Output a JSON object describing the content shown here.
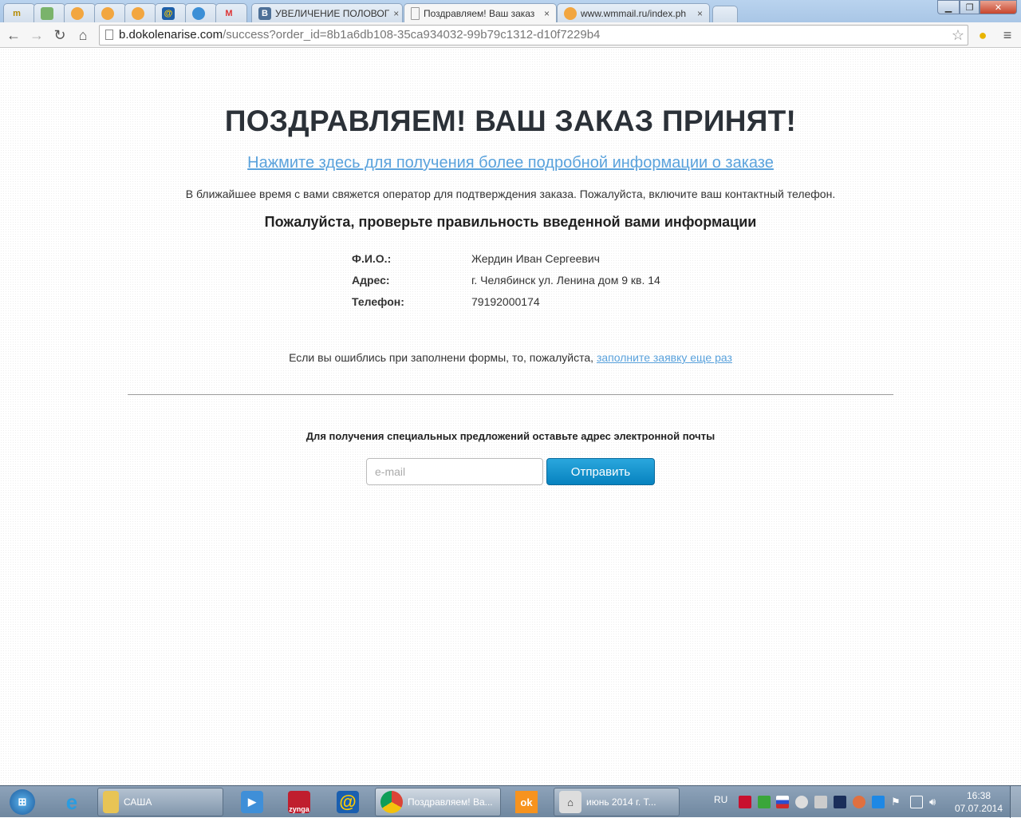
{
  "browser": {
    "tabs": [
      {
        "label": "УВЕЛИЧЕНИЕ ПОЛОВОГ",
        "icon": "vk-icon"
      },
      {
        "label": "Поздравляем! Ваш заказ",
        "icon": "page-icon",
        "active": true
      },
      {
        "label": "www.wmmail.ru/index.ph",
        "icon": "wmmail-icon"
      }
    ],
    "close_glyph": "×",
    "url_host": "b.dokolenarise.com",
    "url_path": "/success?order_id=8b1a6db108-35ca934032-99b79c1312-d10f7229b4"
  },
  "page": {
    "title": "ПОЗДРАВЛЯЕМ! ВАШ ЗАКАЗ ПРИНЯТ!",
    "details_link": "Нажмите здесь для получения более подробной информации о заказе",
    "notice": "В ближайшее время с вами свяжется оператор для подтверждения заказа. Пожалуйста, включите ваш контактный телефон.",
    "check_heading": "Пожалуйста, проверьте правильность введенной вами информации",
    "info": [
      {
        "label": "Ф.И.О.:",
        "value": "Жердин Иван Сергеевич"
      },
      {
        "label": "Адрес:",
        "value": "г. Челябинск ул. Ленина дом 9 кв. 14"
      },
      {
        "label": "Телефон:",
        "value": "79192000174"
      }
    ],
    "mistake_text": "Если вы ошиблись при заполнени формы, то, пожалуйста, ",
    "mistake_link": "заполните заявку еще раз",
    "promo_text": "Для получения специальных предложений оставьте адрес электронной почты",
    "email_placeholder": "e-mail",
    "email_value": "",
    "send_label": "Отправить"
  },
  "taskbar": {
    "items": [
      {
        "label": "САША"
      },
      {
        "label": "Поздравляем! Ва..."
      },
      {
        "label": "июнь 2014 г.    Т..."
      }
    ],
    "zynga_label": "zynga",
    "language": "RU",
    "time": "16:38",
    "date": "07.07.2014"
  }
}
